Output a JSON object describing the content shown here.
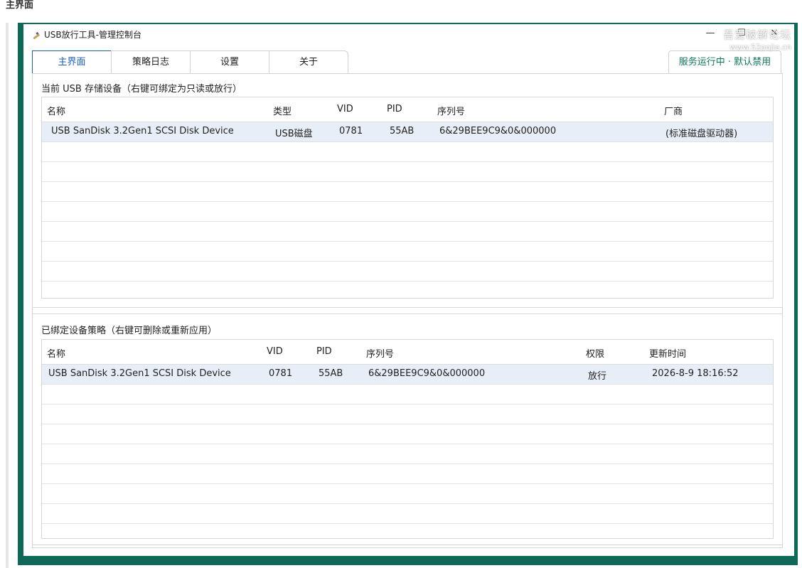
{
  "page": {
    "heading": "主界面"
  },
  "window": {
    "title": "USB放行工具-管理控制台",
    "controls": {
      "minimize": "—",
      "maximize": "☐",
      "close": "✕"
    },
    "watermark": {
      "line1": "吾爱破解论坛",
      "line2": "www.52pojie.cn"
    }
  },
  "tabs": [
    {
      "label": "主界面",
      "active": true
    },
    {
      "label": "策略日志",
      "active": false
    },
    {
      "label": "设置",
      "active": false
    },
    {
      "label": "关于",
      "active": false
    }
  ],
  "status": {
    "text": "服务运行中 · 默认禁用",
    "color": "#0e7a5b"
  },
  "devices": {
    "title": "当前 USB 存储设备（右键可绑定为只读或放行）",
    "columns": [
      "名称",
      "类型",
      "VID",
      "PID",
      "序列号",
      "厂商"
    ],
    "rows": [
      {
        "name": "USB  SanDisk 3.2Gen1 SCSI Disk Device",
        "type": "USB磁盘",
        "vid": "0781",
        "pid": "55AB",
        "serial": "6&29BEE9C9&0&000000",
        "vendor": "(标准磁盘驱动器)"
      }
    ]
  },
  "policies": {
    "title": "已绑定设备策略（右键可删除或重新应用）",
    "columns": [
      "名称",
      "VID",
      "PID",
      "序列号",
      "权限",
      "更新时间"
    ],
    "rows": [
      {
        "name": "USB  SanDisk 3.2Gen1 SCSI Disk Device",
        "vid": "0781",
        "pid": "55AB",
        "serial": "6&29BEE9C9&0&000000",
        "permission": "放行",
        "updated": "2026-8-9 18:16:52"
      }
    ]
  },
  "colors": {
    "frame": "#0e6a58",
    "accent": "#1d5fb6",
    "selected_row": "#e8eef8"
  },
  "icons": {
    "app": "usb-app-icon"
  }
}
